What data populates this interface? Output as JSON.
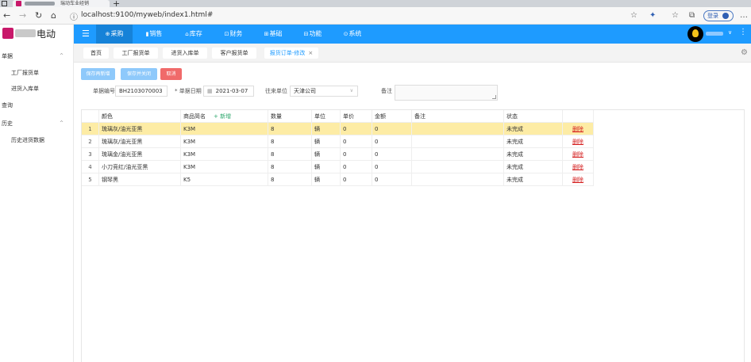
{
  "browser": {
    "tab_title": "瑞动车业经销",
    "new_tab": "+",
    "url": "localhost:9100/myweb/index1.html#",
    "login_label": "登录"
  },
  "app": {
    "brand_text": "电动"
  },
  "sidebar": {
    "items": [
      {
        "label": "单据",
        "type": "group",
        "expanded": true
      },
      {
        "label": "工厂报货单",
        "type": "sub"
      },
      {
        "label": "进货入库单",
        "type": "sub"
      },
      {
        "label": "查询",
        "type": "group",
        "expanded": false
      },
      {
        "label": "历史",
        "type": "group",
        "expanded": true
      },
      {
        "label": "历史进货数据",
        "type": "sub"
      }
    ]
  },
  "topnav": {
    "menus": [
      {
        "label": "采购",
        "icon": "cart-icon",
        "glyph": "⊕",
        "active": true
      },
      {
        "label": "销售",
        "icon": "bar-chart-icon",
        "glyph": "▮",
        "active": false
      },
      {
        "label": "库存",
        "icon": "home-icon",
        "glyph": "⌂",
        "active": false
      },
      {
        "label": "财务",
        "icon": "finance-icon",
        "glyph": "⊡",
        "active": false
      },
      {
        "label": "基础",
        "icon": "base-icon",
        "glyph": "⊞",
        "active": false
      },
      {
        "label": "功能",
        "icon": "function-icon",
        "glyph": "⊟",
        "active": false
      },
      {
        "label": "系统",
        "icon": "system-icon",
        "glyph": "⊙",
        "active": false
      }
    ]
  },
  "pagetabs": {
    "tabs": [
      {
        "label": "首页",
        "active": false,
        "closable": false
      },
      {
        "label": "工厂报货单",
        "active": false,
        "closable": false
      },
      {
        "label": "进货入库单",
        "active": false,
        "closable": false
      },
      {
        "label": "客户报货单",
        "active": false,
        "closable": false
      },
      {
        "label": "报货订单-修改",
        "active": true,
        "closable": true
      }
    ],
    "close_glyph": "×"
  },
  "toolbar": {
    "save_new": "保存再新增",
    "save_close": "保存并关闭",
    "cancel": "取消"
  },
  "form": {
    "doc_no_label": "单据编号",
    "doc_no_value": "BH2103070003",
    "doc_date_label": "* 单据日期",
    "doc_date_value": "2021-03-07",
    "partner_label": "往来单位",
    "partner_value": "天津公司",
    "remark_label": "备注",
    "remark_value": ""
  },
  "grid": {
    "columns": [
      "颜色",
      "商品简名",
      "数量",
      "单位",
      "单价",
      "金额",
      "备注",
      "状态",
      ""
    ],
    "add_label": "+ 新增",
    "rows": [
      {
        "no": "1",
        "color": "琉璃灰/油光亚黑",
        "name": "K3M",
        "qty": "8",
        "unit": "辆",
        "price": "0",
        "amount": "0",
        "remark": "",
        "status": "未完成",
        "action": "删除",
        "selected": true
      },
      {
        "no": "2",
        "color": "琉璃灰/油光亚黑",
        "name": "K3M",
        "qty": "8",
        "unit": "辆",
        "price": "0",
        "amount": "0",
        "remark": "",
        "status": "未完成",
        "action": "删除",
        "selected": false
      },
      {
        "no": "3",
        "color": "琉璃金/油光亚黑",
        "name": "K3M",
        "qty": "8",
        "unit": "辆",
        "price": "0",
        "amount": "0",
        "remark": "",
        "status": "未完成",
        "action": "删除",
        "selected": false
      },
      {
        "no": "4",
        "color": "小刀竞红/油光亚黑",
        "name": "K3M",
        "qty": "8",
        "unit": "辆",
        "price": "0",
        "amount": "0",
        "remark": "",
        "status": "未完成",
        "action": "删除",
        "selected": false
      },
      {
        "no": "5",
        "color": "钢琴黑",
        "name": "K5",
        "qty": "8",
        "unit": "辆",
        "price": "0",
        "amount": "0",
        "remark": "",
        "status": "未完成",
        "action": "删除",
        "selected": false
      }
    ]
  },
  "colors": {
    "nav_blue": "#1e9bff",
    "selected_row": "#fdeca5",
    "delete_red": "#d41e1e",
    "cancel_red": "#f06a6a"
  }
}
